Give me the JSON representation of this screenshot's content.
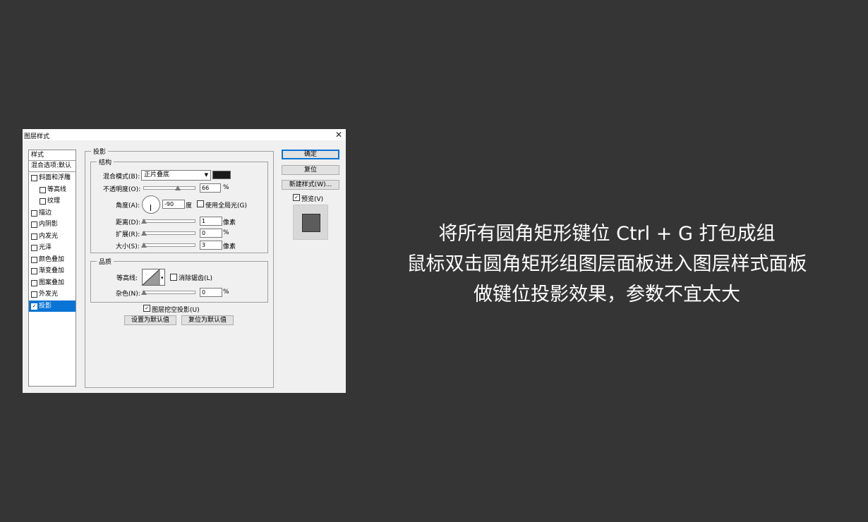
{
  "dialog": {
    "title": "图层样式",
    "styles_header": "样式",
    "blend_options": "混合选项:默认",
    "style_items": [
      {
        "label": "斜面和浮雕",
        "checked": false,
        "indent": false,
        "selected": false
      },
      {
        "label": "等高线",
        "checked": false,
        "indent": true,
        "selected": false
      },
      {
        "label": "纹理",
        "checked": false,
        "indent": true,
        "selected": false
      },
      {
        "label": "描边",
        "checked": false,
        "indent": false,
        "selected": false
      },
      {
        "label": "内阴影",
        "checked": false,
        "indent": false,
        "selected": false
      },
      {
        "label": "内发光",
        "checked": false,
        "indent": false,
        "selected": false
      },
      {
        "label": "光泽",
        "checked": false,
        "indent": false,
        "selected": false
      },
      {
        "label": "颜色叠加",
        "checked": false,
        "indent": false,
        "selected": false
      },
      {
        "label": "渐变叠加",
        "checked": false,
        "indent": false,
        "selected": false
      },
      {
        "label": "图案叠加",
        "checked": false,
        "indent": false,
        "selected": false
      },
      {
        "label": "外发光",
        "checked": false,
        "indent": false,
        "selected": false
      },
      {
        "label": "投影",
        "checked": true,
        "indent": false,
        "selected": true
      }
    ],
    "section_title": "投影",
    "structure": {
      "label": "结构",
      "blend_mode_label": "混合模式(B):",
      "blend_mode_value": "正片叠底",
      "shadow_color": "#1a1a1a",
      "opacity_label": "不透明度(O):",
      "opacity_value": "66",
      "opacity_unit": "%",
      "opacity_fraction": 0.66,
      "angle_label": "角度(A):",
      "angle_value": "-90",
      "angle_unit": "度",
      "global_light_label": "使用全局光(G)",
      "distance_label": "距离(D):",
      "distance_value": "1",
      "distance_unit": "像素",
      "spread_label": "扩展(R):",
      "spread_value": "0",
      "spread_unit": "%",
      "size_label": "大小(S):",
      "size_value": "3",
      "size_unit": "像素"
    },
    "quality": {
      "label": "品质",
      "contour_label": "等高线:",
      "anti_alias_label": "消除锯齿(L)",
      "noise_label": "杂色(N):",
      "noise_value": "0",
      "noise_unit": "%"
    },
    "knockout_label": "图层挖空投影(U)",
    "set_default_button": "设置为默认值",
    "reset_default_button": "复位为默认值",
    "ok_button": "确定",
    "reset_button": "复位",
    "new_style_button": "新建样式(W)...",
    "preview_label": "预览(V)",
    "accent_color": "#0a74d6"
  },
  "caption": {
    "line1": "将所有圆角矩形键位 Ctrl + G 打包成组",
    "line2": "鼠标双击圆角矩形组图层面板进入图层样式面板",
    "line3": "做键位投影效果，参数不宜太大"
  }
}
